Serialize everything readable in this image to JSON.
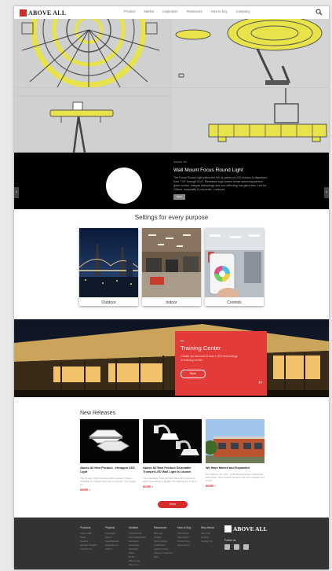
{
  "brand": {
    "name": "ABOVE ALL",
    "tagline": ""
  },
  "nav": {
    "items": [
      "Product",
      "Market",
      "Inspiration",
      "Resources",
      "How to buy",
      "Company"
    ]
  },
  "slider": {
    "kicker": "Above All",
    "title": "Wall Mount Focus Round Light",
    "text": "The Focus Round Light offers the full 4k series of LED fixtures in diameters from 7’x4” through 8’x4”. Recessed high-lumen dense achieving perfect glare control. Integral technology and non-reflecting low-glare lens. Led for Offices, hospitality & corporate. Looks as",
    "button": "More"
  },
  "settings": {
    "title": "Settings for every purpose",
    "cards": [
      {
        "label": "Outdoor"
      },
      {
        "label": "Indoor"
      },
      {
        "label": "Controls"
      }
    ]
  },
  "training": {
    "title": "Training Center",
    "text": "Create an account to learn LED technology in training center.",
    "button": "More",
    "quote_mark": "”"
  },
  "releases": {
    "title": "New Releases",
    "items": [
      {
        "title": "Above All New Product - Hexagon LED Light",
        "text": "The hexagon light features with a hexagon shape. Available in multiple sizes and mountings. The design fo...",
        "more": "MORE »"
      },
      {
        "title": "Above All New Product Selectable Trumpet LED Wall Light is Launch",
        "text": "The selectable Trumpet LED Wall Light is ideal for lighting as well as a facade, the lighting unit of all ty...",
        "more": "MORE »"
      },
      {
        "title": "We Have Moved and Expanded",
        "text": "As of March 7th, 2017, 1736 Monrovia Ave in Alhambra (Monrovia), New location focuses and new management at the...",
        "more": "MORE »"
      }
    ],
    "more_button": "More"
  },
  "footer": {
    "columns": [
      {
        "heading": "Products",
        "items": [
          "Indoor LED",
          "Flood",
          "Outdoor",
          "Exterior Portable",
          "Controls etc"
        ]
      },
      {
        "heading": "Projects",
        "items": [
          "Hospitality",
          "Airport",
          "Food Markets",
          "Retail Stores",
          "Offices"
        ]
      },
      {
        "heading": "Markets",
        "items": [
          "Architectural",
          "Auto Dealerships",
          "Education",
          "Healthcare",
          "Industrial",
          "Office",
          "Retail",
          "Warehouse",
          "Museums"
        ]
      },
      {
        "heading": "Resources",
        "items": [
          "Manuals",
          "Articles",
          "Photo Gallery",
          "Certificates",
          "Lighting Guide",
          "Videos & Galleries",
          "Blog"
        ]
      },
      {
        "heading": "How to Buy",
        "items": [
          "Distributors",
          "Sales Reps",
          "Online Store",
          "Quote Form"
        ]
      },
      {
        "heading": "Why Above",
        "items": [
          "About Us",
          "Careers",
          "Contact Us"
        ]
      }
    ],
    "follow": "Follow us",
    "social_icons": [
      "twitter-icon",
      "linkedin-icon",
      "youtube-icon"
    ]
  },
  "colors": {
    "brand_red": "#d52b2b",
    "footer_bg": "#333333",
    "fixture_yellow": "#e8e34a"
  }
}
